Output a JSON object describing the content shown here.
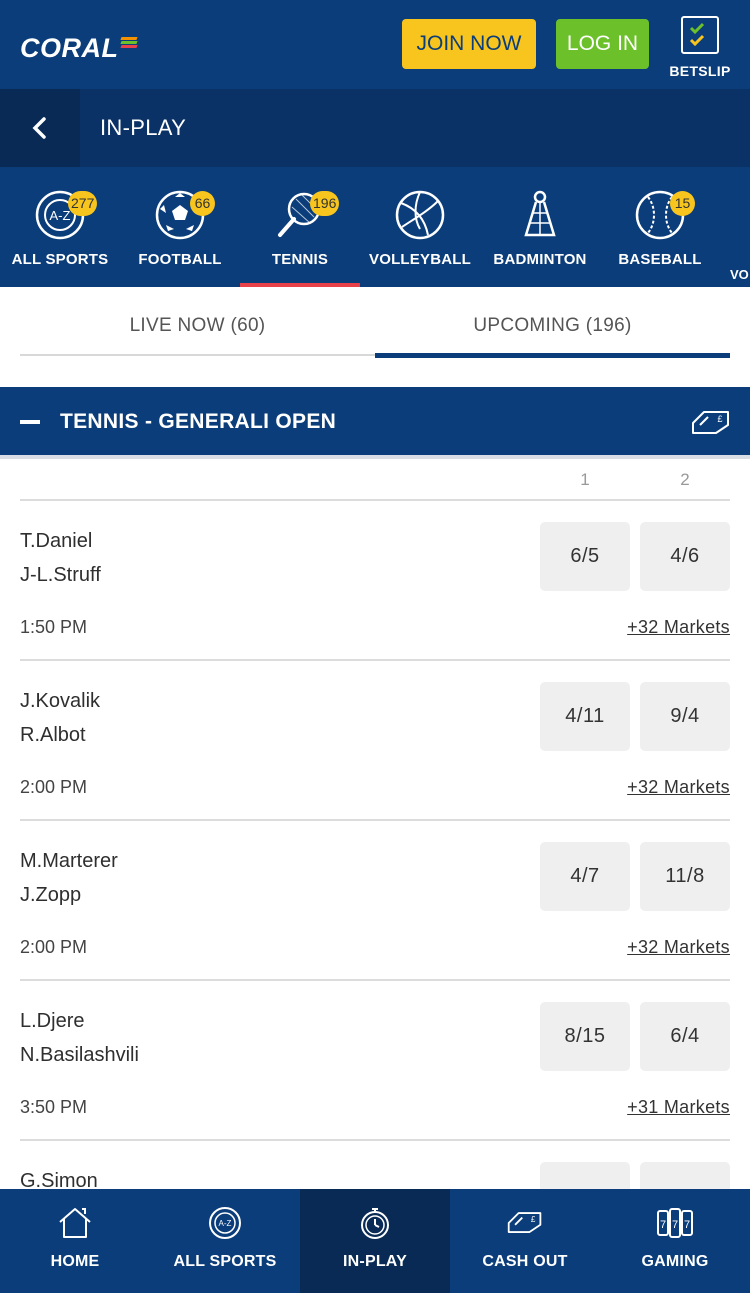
{
  "header": {
    "logo": "CORAL",
    "join_label": "JOIN NOW",
    "login_label": "LOG IN",
    "betslip_label": "BETSLIP"
  },
  "titlebar": {
    "title": "IN-PLAY"
  },
  "sports": [
    {
      "label": "ALL SPORTS",
      "badge": "277",
      "icon": "az-icon"
    },
    {
      "label": "FOOTBALL",
      "badge": "66",
      "icon": "football-icon"
    },
    {
      "label": "TENNIS",
      "badge": "196",
      "icon": "tennis-icon",
      "active": true
    },
    {
      "label": "VOLLEYBALL",
      "badge": "",
      "icon": "volleyball-icon"
    },
    {
      "label": "BADMINTON",
      "badge": "",
      "icon": "shuttlecock-icon"
    },
    {
      "label": "BASEBALL",
      "badge": "15",
      "icon": "baseball-icon"
    }
  ],
  "sports_overflow_label": "VO",
  "tabs": [
    {
      "label": "LIVE NOW (60)"
    },
    {
      "label": "UPCOMING (196)",
      "active": true
    }
  ],
  "section": {
    "title": "TENNIS - GENERALI OPEN"
  },
  "columns": [
    "1",
    "2"
  ],
  "events": [
    {
      "p1": "T.Daniel",
      "p2": "J-L.Struff",
      "time": "1:50 PM",
      "odds1": "6/5",
      "odds2": "4/6",
      "markets": "+32 Markets"
    },
    {
      "p1": "J.Kovalik",
      "p2": "R.Albot",
      "time": "2:00 PM",
      "odds1": "4/11",
      "odds2": "9/4",
      "markets": "+32 Markets"
    },
    {
      "p1": "M.Marterer",
      "p2": "J.Zopp",
      "time": "2:00 PM",
      "odds1": "4/7",
      "odds2": "11/8",
      "markets": "+32 Markets"
    },
    {
      "p1": "L.Djere",
      "p2": "N.Basilashvili",
      "time": "3:50 PM",
      "odds1": "8/15",
      "odds2": "6/4",
      "markets": "+31 Markets"
    },
    {
      "p1": "G.Simon",
      "p2": "",
      "time": "",
      "odds1": "",
      "odds2": "",
      "markets": ""
    }
  ],
  "bottomnav": [
    {
      "label": "HOME",
      "icon": "home-icon"
    },
    {
      "label": "ALL SPORTS",
      "icon": "az-icon"
    },
    {
      "label": "IN-PLAY",
      "icon": "stopwatch-icon",
      "active": true
    },
    {
      "label": "CASH OUT",
      "icon": "cashout-icon"
    },
    {
      "label": "GAMING",
      "icon": "slots-icon"
    }
  ],
  "colors": {
    "brand_blue": "#0b3d7a",
    "dark_blue": "#082a55",
    "join_yellow": "#f7c51e",
    "login_green": "#6cc12a",
    "active_red": "#e8414a"
  }
}
